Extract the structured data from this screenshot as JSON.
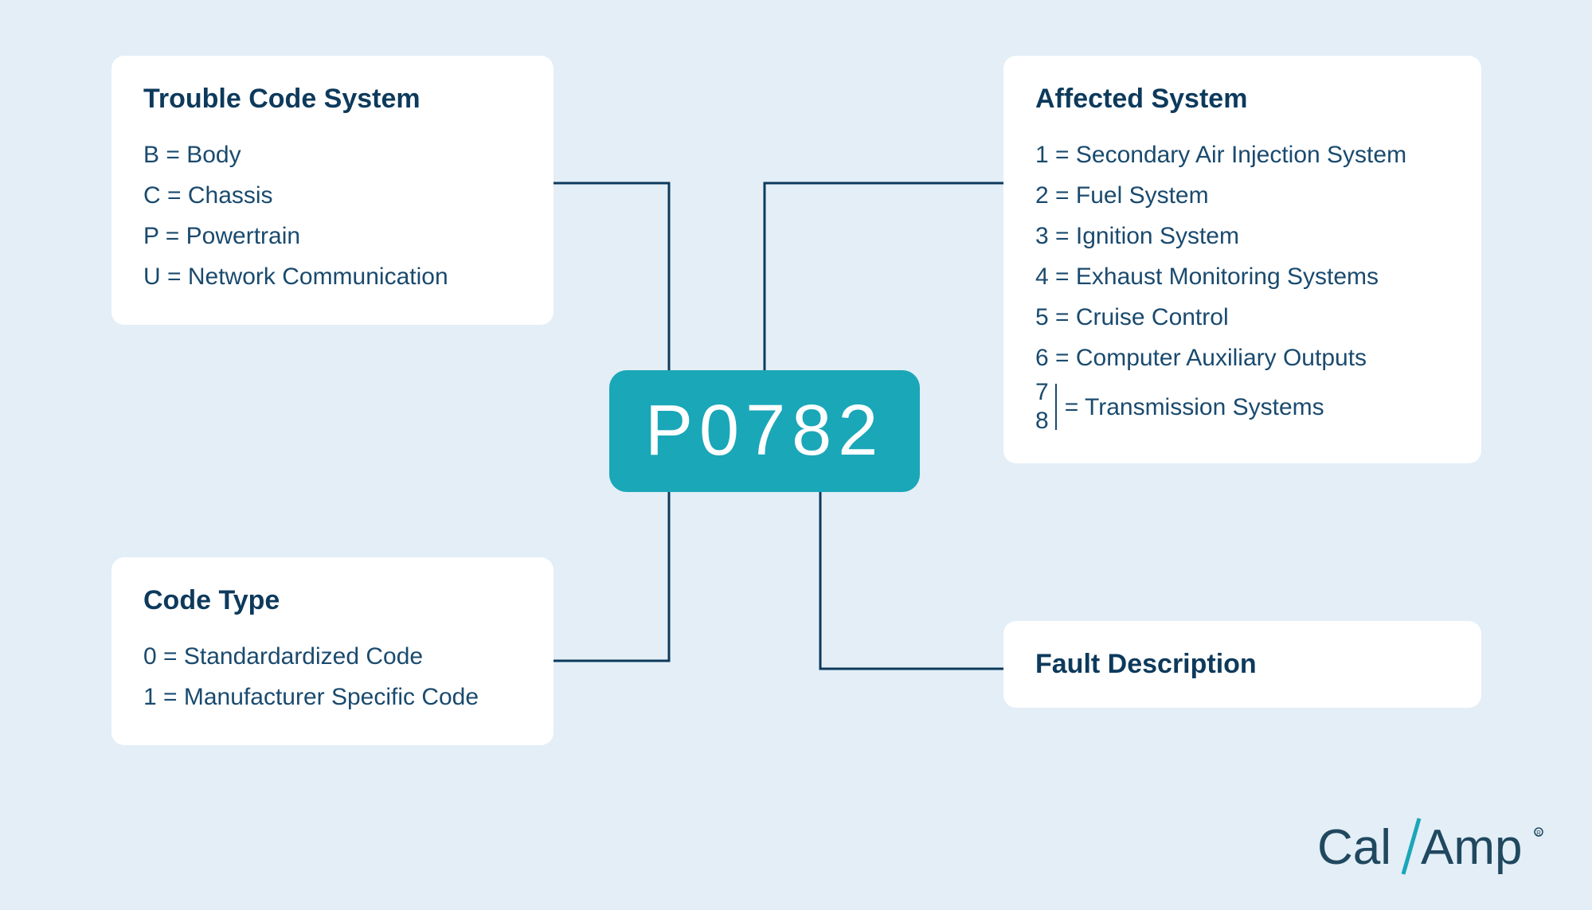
{
  "code": "P0782",
  "trouble_code_system": {
    "title": "Trouble Code System",
    "items": [
      "B = Body",
      "C = Chassis",
      "P = Powertrain",
      "U = Network Communication"
    ]
  },
  "affected_system": {
    "title": "Affected System",
    "items": [
      "1 = Secondary Air Injection System",
      "2 = Fuel System",
      "3 = Ignition System",
      "4 = Exhaust Monitoring Systems",
      "5 = Cruise Control",
      "6 = Computer Auxiliary Outputs"
    ],
    "combined": {
      "n1": "7",
      "n2": "8",
      "label": "= Transmission Systems"
    }
  },
  "code_type": {
    "title": "Code Type",
    "items": [
      "0 = Standardardized Code",
      "1 = Manufacturer Specific Code"
    ]
  },
  "fault_description": {
    "title": "Fault Description"
  },
  "brand": {
    "part1": "Cal",
    "part2": "Amp"
  }
}
